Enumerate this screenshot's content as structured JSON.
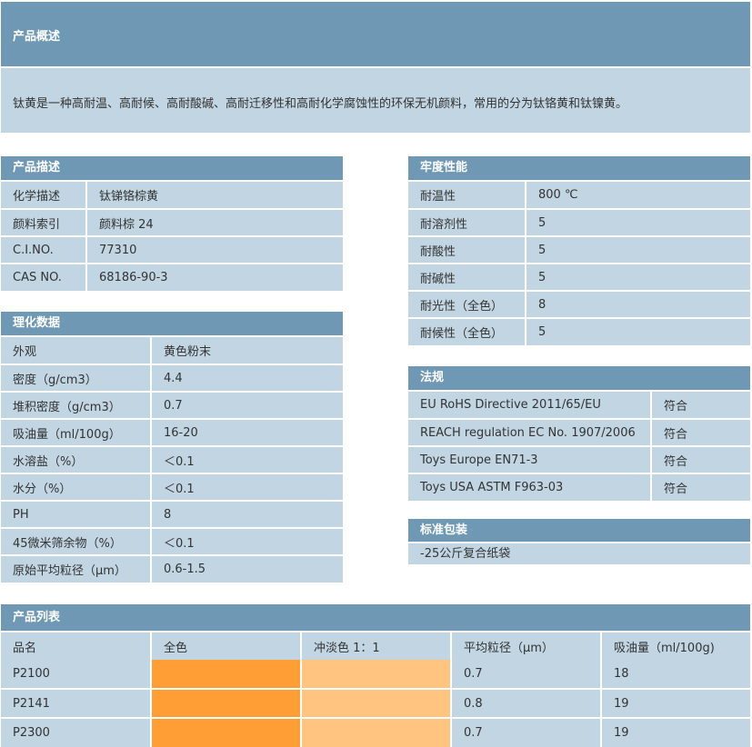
{
  "overview": {
    "title": "产品概述",
    "text": "钛黄是一种高耐温、高耐候、高耐酸碱、高耐迁移性和高耐化学腐蚀性的环保无机颜料，常用的分为钛铬黄和钛镍黄。"
  },
  "description": {
    "title": "产品描述",
    "rows": [
      {
        "k": "化学描述",
        "v": "钛锑铬棕黄"
      },
      {
        "k": "颜料索引",
        "v": "颜料棕 24"
      },
      {
        "k": "C.I.NO.",
        "v": "77310"
      },
      {
        "k": "CAS NO.",
        "v": "68186-90-3"
      }
    ]
  },
  "physchem": {
    "title": "理化数据",
    "rows": [
      {
        "k": "外观",
        "v": "黄色粉末"
      },
      {
        "k": "密度（g/cm3）",
        "v": "4.4"
      },
      {
        "k": "堆积密度（g/cm3）",
        "v": "0.7"
      },
      {
        "k": "吸油量（ml/100g）",
        "v": "16-20"
      },
      {
        "k": "水溶盐（%）",
        "v": "＜0.1"
      },
      {
        "k": "水分（%）",
        "v": "＜0.1"
      },
      {
        "k": "PH",
        "v": "8"
      },
      {
        "k": "45微米筛余物（%）",
        "v": "＜0.1"
      },
      {
        "k": "原始平均粒径（μm）",
        "v": "0.6-1.5"
      }
    ]
  },
  "fastness": {
    "title": "牢度性能",
    "rows": [
      {
        "k": "耐温性",
        "v": "800 ℃"
      },
      {
        "k": "耐溶剂性",
        "v": "5"
      },
      {
        "k": "耐酸性",
        "v": "5"
      },
      {
        "k": "耐碱性",
        "v": "5"
      },
      {
        "k": "耐光性（全色）",
        "v": "8"
      },
      {
        "k": "耐候性（全色）",
        "v": "5"
      }
    ]
  },
  "regulation": {
    "title": "法规",
    "rows": [
      {
        "k": "EU RoHS Directive 2011/65/EU",
        "v": "符合"
      },
      {
        "k": "REACH regulation EC No. 1907/2006",
        "v": "符合"
      },
      {
        "k": "Toys Europe EN71-3",
        "v": "符合"
      },
      {
        "k": "Toys USA ASTM F963-03",
        "v": "符合"
      }
    ]
  },
  "packaging": {
    "title": "标准包装",
    "text": "-25公斤复合纸袋"
  },
  "product_list": {
    "title": "产品列表",
    "headers": [
      "品名",
      "全色",
      "冲淡色 1：1",
      "平均粒径（μm）",
      "吸油量（ml/100g)"
    ],
    "rows": [
      {
        "name": "P2100",
        "size": "0.7",
        "oil": "18"
      },
      {
        "name": "P2141",
        "size": "0.8",
        "oil": "19"
      },
      {
        "name": "P2300",
        "size": "0.7",
        "oil": "19"
      }
    ],
    "colors": {
      "full": "#ff9e35",
      "tint": "#ffc47f"
    }
  },
  "colors": {
    "header": "#6f98b5",
    "cell": "#c2d5e3"
  }
}
